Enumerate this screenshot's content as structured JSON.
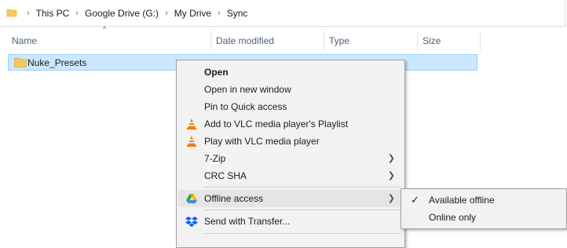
{
  "breadcrumb": {
    "items": [
      "This PC",
      "Google Drive (G:)",
      "My Drive",
      "Sync"
    ],
    "separator": "›"
  },
  "columns": {
    "name": "Name",
    "date_modified": "Date modified",
    "type": "Type",
    "size": "Size",
    "sort_indicator": "^"
  },
  "file_list": {
    "rows": [
      {
        "name": "Nuke_Presets",
        "icon": "folder-icon"
      }
    ]
  },
  "context_menu": {
    "items": [
      {
        "label": "Open",
        "bold": true
      },
      {
        "label": "Open in new window"
      },
      {
        "label": "Pin to Quick access"
      },
      {
        "label": "Add to VLC media player's Playlist",
        "icon": "vlc-icon"
      },
      {
        "label": "Play with VLC media player",
        "icon": "vlc-icon"
      },
      {
        "label": "7-Zip",
        "submenu": true
      },
      {
        "label": "CRC SHA",
        "submenu": true
      },
      {
        "label": "Offline access",
        "icon": "google-drive-icon",
        "submenu": true,
        "highlighted": true
      },
      {
        "label": "Send with Transfer...",
        "icon": "dropbox-icon"
      }
    ]
  },
  "offline_submenu": {
    "items": [
      {
        "label": "Available offline",
        "checked": true
      },
      {
        "label": "Online only",
        "checked": false
      }
    ]
  },
  "colors": {
    "selection_bg": "#cce8ff",
    "selection_border": "#99d1ff",
    "folder": "#f8c860",
    "vlc_orange": "#f07d00",
    "dropbox_blue": "#0061fe"
  }
}
